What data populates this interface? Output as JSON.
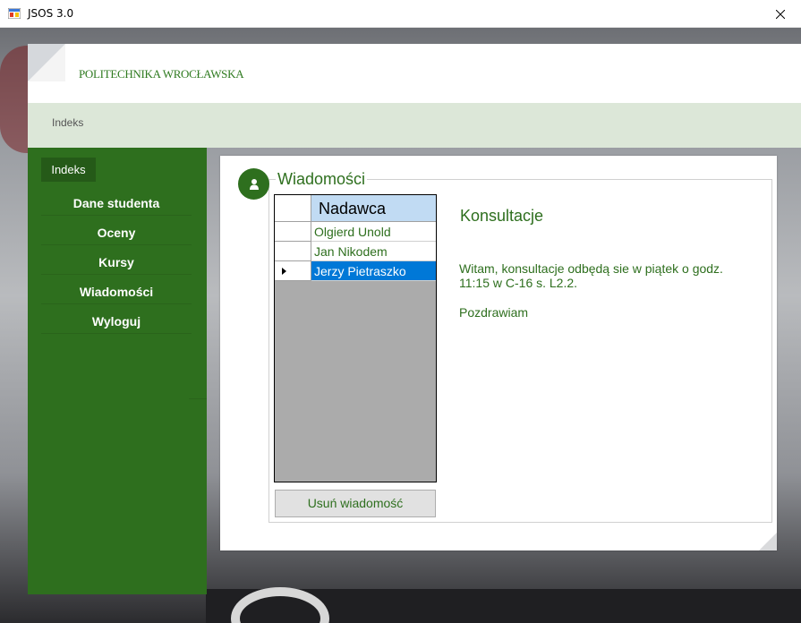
{
  "window": {
    "title": "JSOS 3.0"
  },
  "header": {
    "logo_text": "POLITECHNIKA WROCŁAWSKA"
  },
  "breadcrumb": {
    "label": "Indeks"
  },
  "sidebar": {
    "active_label": "Indeks",
    "items": [
      {
        "label": "Dane studenta"
      },
      {
        "label": "Oceny"
      },
      {
        "label": "Kursy"
      },
      {
        "label": "Wiadomości"
      },
      {
        "label": "Wyloguj"
      }
    ]
  },
  "messages": {
    "title": "Wiadomości",
    "column_header": "Nadawca",
    "senders": [
      "Olgierd Unold",
      "Jan Nikodem",
      "Jerzy Pietraszko"
    ],
    "selected_index": 2,
    "delete_button": "Usuń wiadomość",
    "subject": "Konsultacje",
    "body": "Witam, konsultacje odbędą sie w piątek o godz. 11:15 w C-16 s. L2.2.",
    "closing": "Pozdrawiam"
  },
  "colors": {
    "brand_green": "#2e6f1e",
    "selection_blue": "#0078d7",
    "header_blue": "#c1dbf3"
  },
  "icons": [
    "app-icon",
    "close-icon",
    "user-icon",
    "row-pointer-icon"
  ]
}
